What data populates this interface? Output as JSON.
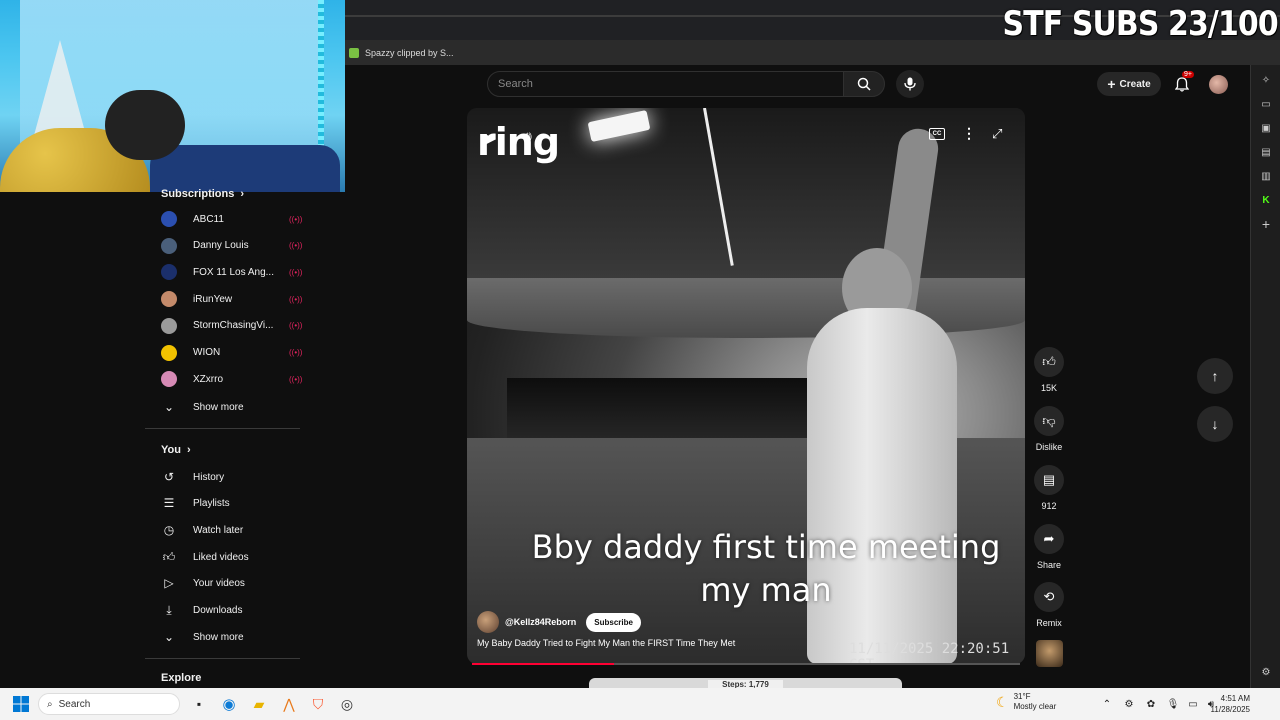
{
  "overlay": {
    "subs_text": "STF SUBS 23/100"
  },
  "browser": {
    "tab_title": "Spazzy clipped by S..."
  },
  "search": {
    "placeholder": "Search"
  },
  "header": {
    "create_label": "Create",
    "notif_badge": "9+"
  },
  "sidebar": {
    "subscriptions_title": "Subscriptions",
    "subscriptions": [
      {
        "name": "ABC11",
        "color": "#2b4fb0"
      },
      {
        "name": "Danny Louis",
        "color": "#4a5f7a"
      },
      {
        "name": "FOX 11 Los Ang...",
        "color": "#1b2f6b"
      },
      {
        "name": "iRunYew",
        "color": "#c48a6a"
      },
      {
        "name": "StormChasingVi...",
        "color": "#9a9a9a"
      },
      {
        "name": "WION",
        "color": "#f2c200"
      },
      {
        "name": "XZxrro",
        "color": "#d68ab5"
      }
    ],
    "show_more_1": "Show more",
    "you_title": "You",
    "you_items": [
      "History",
      "Playlists",
      "Watch later",
      "Liked videos",
      "Your videos",
      "Downloads"
    ],
    "show_more_2": "Show more",
    "explore_title": "Explore"
  },
  "video": {
    "logo_text": "ring",
    "cc_label": "CC",
    "caption_line1": "Bby daddy first time meeting",
    "caption_line2": "my man",
    "timestamp": "11/11/2025 22:20:51 CST",
    "channel": "@Kellz84Reborn",
    "subscribe_label": "Subscribe",
    "title": "My Baby Daddy Tried to Fight My Man the FIRST Time They Met",
    "progress_fraction": 0.26,
    "next_peek_text": "Steps: 1,779"
  },
  "actions": {
    "like_count": "15K",
    "dislike_label": "Dislike",
    "comment_count": "912",
    "share_label": "Share",
    "remix_label": "Remix"
  },
  "taskbar": {
    "search_placeholder": "Search",
    "weather_temp": "31°F",
    "weather_desc": "Mostly clear",
    "time": "4:51 AM",
    "date": "11/28/2025"
  }
}
